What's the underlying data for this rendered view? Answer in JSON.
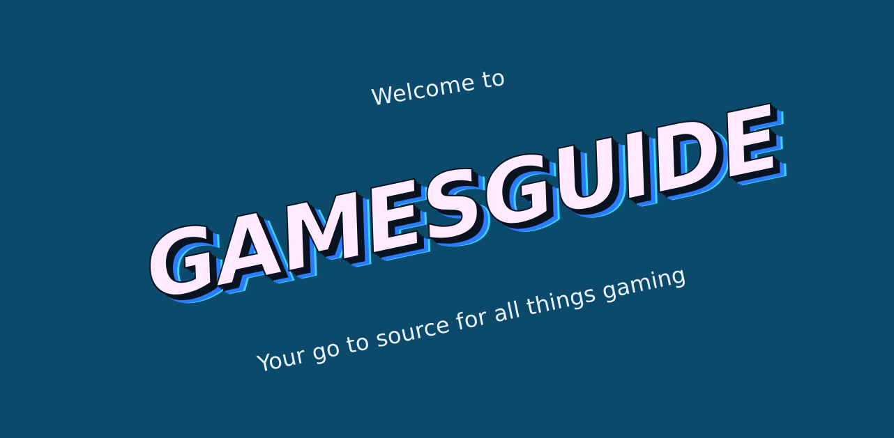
{
  "hero": {
    "welcome_text": "Welcome to",
    "title": "GAMESGUIDE",
    "tagline": "Your go to source for all things gaming"
  },
  "colors": {
    "background": "#0b4a6b",
    "title_fill": "#ffeaff",
    "title_outline": "#0a1320",
    "title_shadow_blue": "#2a7bff",
    "title_shadow_cyan": "#3ad6ff",
    "text": "#e9f0ff"
  }
}
